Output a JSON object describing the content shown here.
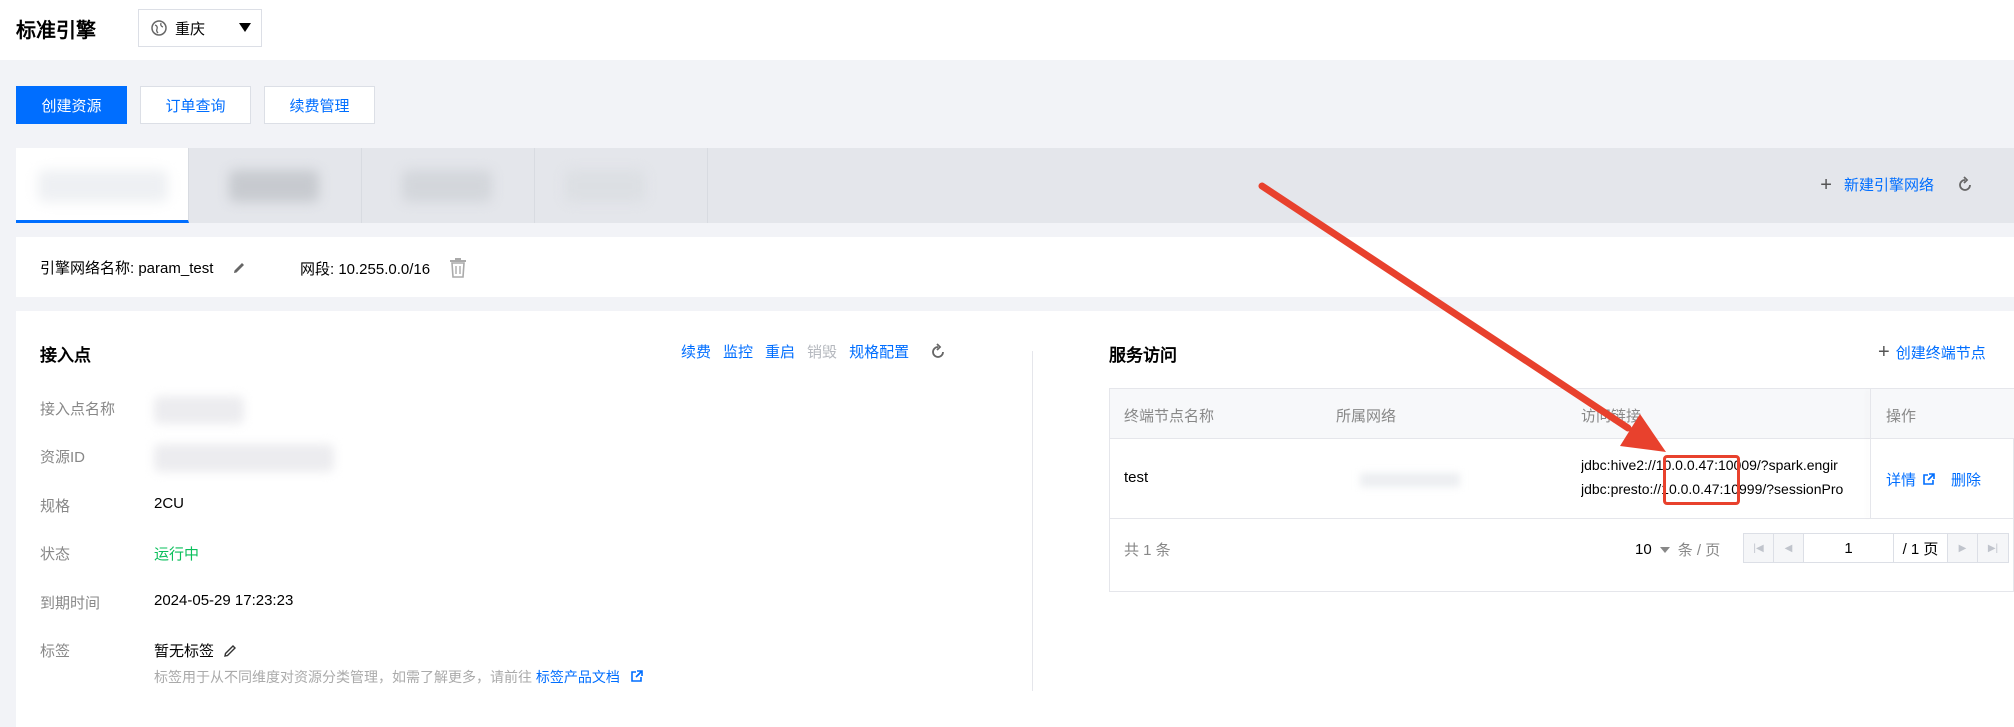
{
  "header": {
    "title": "标准引擎",
    "region": "重庆"
  },
  "actions": {
    "create": "创建资源",
    "orders": "订单查询",
    "renew": "续费管理"
  },
  "tabs": {
    "new_network": "新建引擎网络"
  },
  "network": {
    "name_label": "引擎网络名称: param_test",
    "segment_label": "网段: 10.255.0.0/16"
  },
  "access_point": {
    "title": "接入点",
    "links": {
      "renew": "续费",
      "monitor": "监控",
      "restart": "重启",
      "destroy": "销毁",
      "spec": "规格配置"
    },
    "fields": {
      "name_label": "接入点名称",
      "id_label": "资源ID",
      "spec_label": "规格",
      "spec_value": "2CU",
      "status_label": "状态",
      "status_value": "运行中",
      "expire_label": "到期时间",
      "expire_value": "2024-05-29 17:23:23",
      "tag_label": "标签",
      "tag_value": "暂无标签",
      "tag_hint": "标签用于从不同维度对资源分类管理，如需了解更多，请前往",
      "tag_link": "标签产品文档"
    }
  },
  "service": {
    "title": "服务访问",
    "create_label": "创建终端节点",
    "columns": {
      "name": "终端节点名称",
      "network": "所属网络",
      "access": "访问链接",
      "ops": "操作"
    },
    "row": {
      "name": "test",
      "hive": "jdbc:hive2://10.0.0.47:10009/?spark.engir",
      "presto": "jdbc:presto://10.0.0.47:10999/?sessionPro",
      "detail": "详情",
      "delete": "删除"
    },
    "footer": {
      "total": "共 1 条",
      "page_size": "10",
      "per_page": "条 / 页",
      "page": "1",
      "page_total": "/ 1 页"
    }
  },
  "colors": {
    "accent": "#006eff",
    "status_green": "#0abf5b",
    "annotation_red": "#e8412d"
  }
}
